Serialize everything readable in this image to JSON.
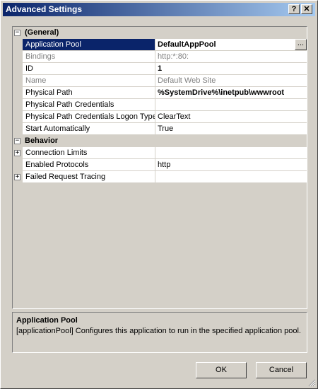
{
  "window": {
    "title": "Advanced Settings",
    "help_glyph": "?",
    "close_glyph": "✕"
  },
  "grid": {
    "categories": [
      {
        "label": "(General)",
        "expander": "−",
        "properties": [
          {
            "name": "Application Pool",
            "value": "DefaultAppPool",
            "ellipsis": "..."
          },
          {
            "name": "Bindings",
            "value": "http:*:80:"
          },
          {
            "name": "ID",
            "value": "1"
          },
          {
            "name": "Name",
            "value": "Default Web Site"
          },
          {
            "name": "Physical Path",
            "value": "%SystemDrive%\\inetpub\\wwwroot"
          },
          {
            "name": "Physical Path Credentials",
            "value": ""
          },
          {
            "name": "Physical Path Credentials Logon Type",
            "value": "ClearText"
          },
          {
            "name": "Start Automatically",
            "value": "True"
          }
        ]
      },
      {
        "label": "Behavior",
        "expander": "−",
        "properties": [
          {
            "name": "Connection Limits",
            "value": "",
            "expander": "+"
          },
          {
            "name": "Enabled Protocols",
            "value": "http"
          },
          {
            "name": "Failed Request Tracing",
            "value": "",
            "expander": "+"
          }
        ]
      }
    ]
  },
  "description": {
    "title": "Application Pool",
    "text": "[applicationPool] Configures this application to run in the specified application pool."
  },
  "buttons": {
    "ok": "OK",
    "cancel": "Cancel"
  },
  "colors": {
    "titlebar_start": "#0a246a",
    "titlebar_end": "#a6caf0",
    "selection": "#0a246a",
    "face": "#d4d0c8"
  }
}
